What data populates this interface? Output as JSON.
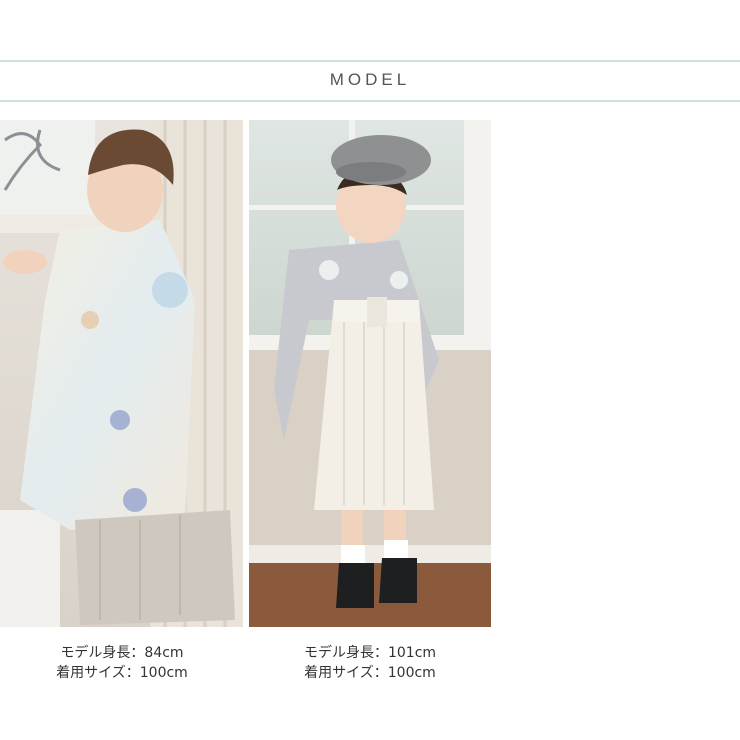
{
  "section": {
    "title": "MODEL"
  },
  "models": [
    {
      "height_label": "モデル身長：84cm",
      "size_label": "着用サイズ：100cm"
    },
    {
      "height_label": "モデル身長：101cm",
      "size_label": "着用サイズ：100cm"
    }
  ]
}
